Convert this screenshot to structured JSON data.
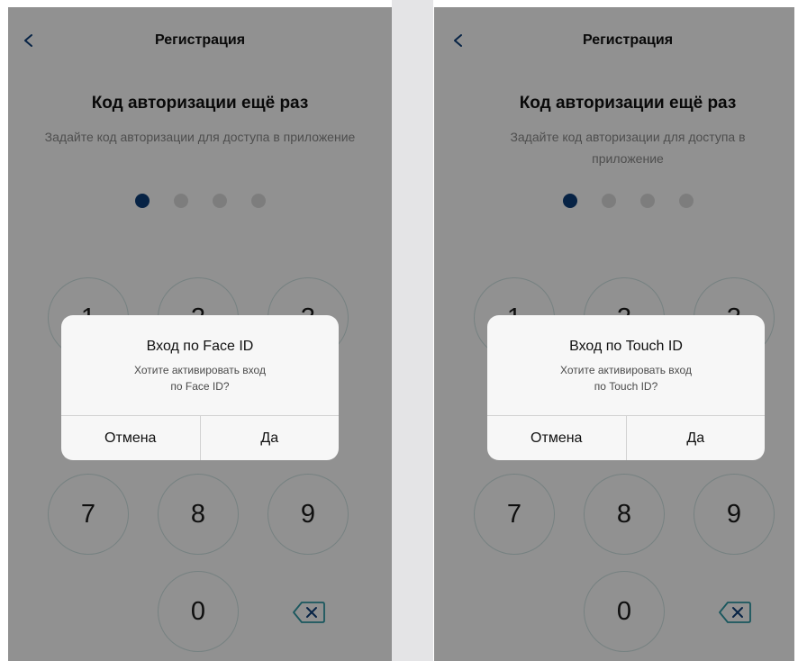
{
  "screens": [
    {
      "header_title": "Регистрация",
      "heading": "Код авторизации ещё раз",
      "subtitle": "Задайте код авторизации для доступа в приложение",
      "pin_entered": 1,
      "pin_length": 4,
      "keypad": [
        "1",
        "2",
        "3",
        "7",
        "8",
        "9",
        "0"
      ],
      "dialog": {
        "title": "Вход по Face ID",
        "message_line1": "Хотите активировать вход",
        "message_line2": "по Face ID?",
        "cancel": "Отмена",
        "confirm": "Да"
      }
    },
    {
      "header_title": "Регистрация",
      "heading": "Код авторизации ещё раз",
      "subtitle": "Задайте код авторизации для доступа в приложение",
      "pin_entered": 1,
      "pin_length": 4,
      "keypad": [
        "1",
        "2",
        "3",
        "7",
        "8",
        "9",
        "0"
      ],
      "dialog": {
        "title": "Вход по Touch ID",
        "message_line1": "Хотите активировать вход",
        "message_line2": "по Touch ID?",
        "cancel": "Отмена",
        "confirm": "Да"
      }
    }
  ],
  "icons": {
    "back": "chevron-left-icon",
    "delete": "backspace-icon"
  },
  "colors": {
    "pin_filled": "#0d3e7a",
    "pin_empty": "#dcdcdc",
    "accent": "#0d3e7a",
    "key_border": "#cfe3e3"
  }
}
